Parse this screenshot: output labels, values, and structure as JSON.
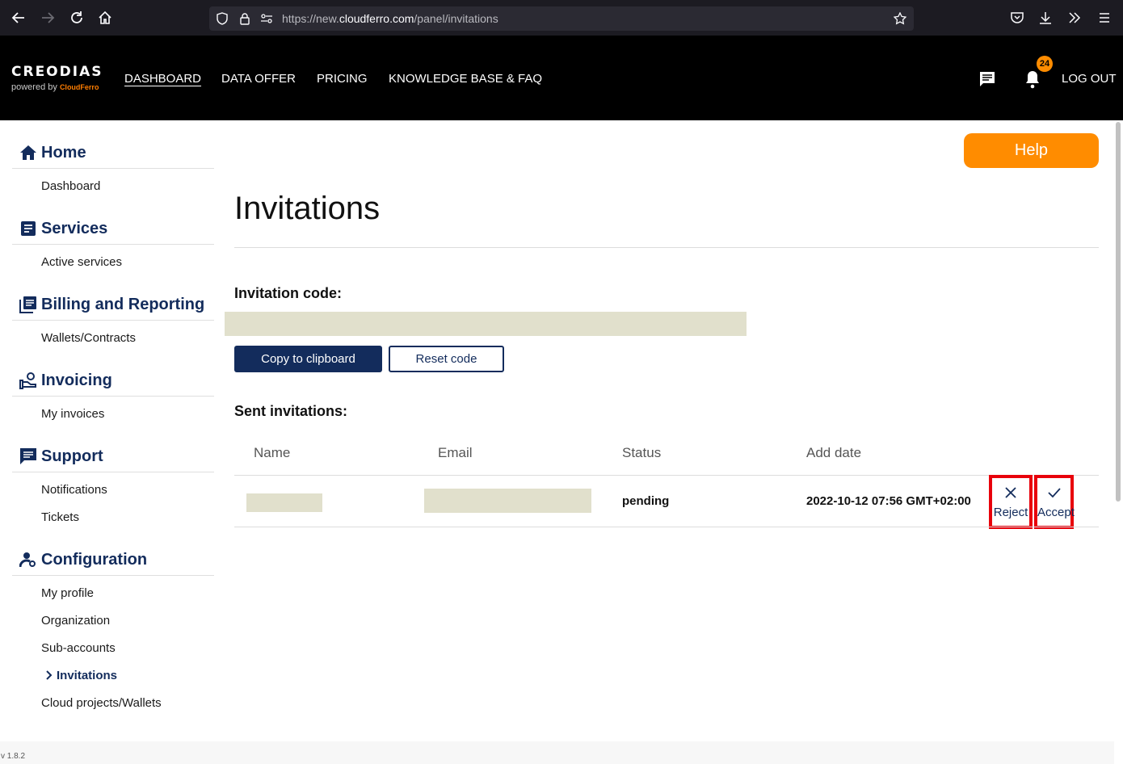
{
  "browser": {
    "url_prefix": "https://new.",
    "url_host": "cloudferro.com",
    "url_path": "/panel/invitations"
  },
  "brand": {
    "logo_text": "CREODIAS",
    "powered_by": "powered by",
    "partner": "CloudFerro"
  },
  "topnav": [
    {
      "label": "DASHBOARD",
      "active": true
    },
    {
      "label": "DATA OFFER"
    },
    {
      "label": "PRICING"
    },
    {
      "label": "KNOWLEDGE BASE & FAQ"
    }
  ],
  "header": {
    "notifications_count": "24",
    "logout_label": "LOG OUT"
  },
  "sidebar": {
    "sections": [
      {
        "label": "Home",
        "icon": "home-icon",
        "items": [
          "Dashboard"
        ]
      },
      {
        "label": "Services",
        "icon": "services-icon",
        "items": [
          "Active services"
        ]
      },
      {
        "label": "Billing and Reporting",
        "icon": "billing-icon",
        "items": [
          "Wallets/Contracts"
        ]
      },
      {
        "label": "Invoicing",
        "icon": "invoicing-icon",
        "items": [
          "My invoices"
        ]
      },
      {
        "label": "Support",
        "icon": "support-icon",
        "items": [
          "Notifications",
          "Tickets"
        ]
      },
      {
        "label": "Configuration",
        "icon": "configuration-icon",
        "items": [
          "My profile",
          "Organization",
          "Sub-accounts",
          "Invitations",
          "Cloud projects/Wallets"
        ]
      }
    ],
    "active_item": "Invitations"
  },
  "main": {
    "help_label": "Help",
    "title": "Invitations",
    "invitation_code_label": "Invitation code:",
    "copy_label": "Copy to clipboard",
    "reset_label": "Reset code",
    "sent_label": "Sent invitations:",
    "table": {
      "headers": [
        "Name",
        "Email",
        "Status",
        "Add date"
      ],
      "rows": [
        {
          "name": "",
          "email": "",
          "status": "pending",
          "add_date": "2022-10-12 07:56 GMT+02:00"
        }
      ]
    },
    "reject_label": "Reject",
    "accept_label": "Accept"
  },
  "footer": {
    "version": "v 1.8.2"
  },
  "colors": {
    "navy": "#132c5c",
    "orange": "#ff8c00",
    "highlight_red": "#e8000b",
    "redaction": "#e1e0cc"
  }
}
